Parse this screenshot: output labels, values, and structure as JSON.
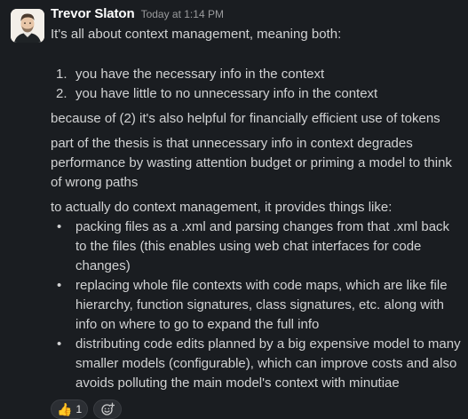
{
  "message": {
    "author": "Trevor Slaton",
    "timestamp": "Today at 1:14 PM",
    "intro": "It's all about context management, meaning both:",
    "numbered": [
      {
        "num": "1.",
        "text": "you have the necessary info in the context"
      },
      {
        "num": "2.",
        "text": "you have little to no unnecessary info in the context"
      }
    ],
    "para_tokens": "because of (2) it's also helpful for financially efficient use of tokens",
    "para_thesis": "part of the thesis is that unnecessary info in context degrades performance by wasting attention budget or priming a model to think of wrong paths",
    "para_lead": "to actually do context management, it provides things like:",
    "bullets": [
      "packing files as a .xml and parsing changes from that .xml back to the files (this enables using web chat interfaces for code changes)",
      "replacing whole file contexts with code maps, which are like file hierarchy, function signatures, class signatures, etc. along with info on where to go to expand the full info",
      "distributing code edits planned by a big expensive model to many smaller models (configurable), which can improve costs and also avoids polluting the main model's context with minutiae"
    ],
    "bullet_char": "•"
  },
  "reactions": [
    {
      "emoji": "👍",
      "icon": "thumbs-up-icon",
      "count": "1"
    }
  ],
  "add_reaction_icon": "add-reaction-icon",
  "colors": {
    "background": "#1a1d21",
    "text": "#d1d2d3",
    "name": "#ffffff",
    "timestamp": "#9a9b9d"
  }
}
